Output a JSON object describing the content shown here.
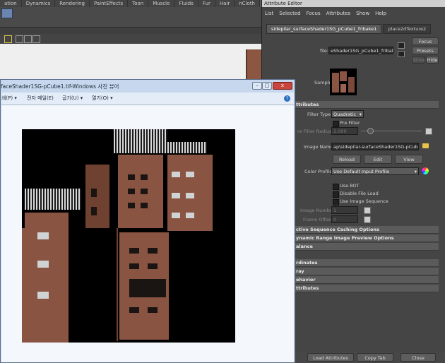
{
  "maya": {
    "shelf_tabs": [
      "ation",
      "Dynamics",
      "Rendering",
      "PaintEffects",
      "Toon",
      "Muscle",
      "Fluids",
      "Fur",
      "Hair",
      "nCloth",
      "Custom"
    ],
    "active_shelf_tab": "Custom"
  },
  "attribute_editor": {
    "title": "Attribute Editor",
    "menu": [
      "List",
      "Selected",
      "Focus",
      "Attributes",
      "Show",
      "Help"
    ],
    "tabs": [
      "sidepilar_surfaceShader1SG_pCube1_fribake1",
      "place2dTexture2"
    ],
    "focus_button": "Focus",
    "presets_button": "Presets",
    "show_button": "Show",
    "hide_button": "Hide",
    "file_label": "file:",
    "file_value": "eShader1SG_pCube1_fribake1",
    "sample_label": "Sample",
    "sections": {
      "attributes": "ttributes",
      "caching": "ctive Sequence Caching Options",
      "dynamic_range": "ynamic Range Image Preview Options",
      "balance": "alance",
      "coordinates": "rdinates",
      "ray": "ray",
      "behavior": "ehavior",
      "extra": "ttributes"
    },
    "filter_type_label": "Filter Type",
    "filter_type_value": "Quadratic",
    "pre_filter_label": "Pre Filter",
    "pre_filter_radius_label": "re Filter Radius",
    "pre_filter_radius_value": "2.000",
    "image_name_label": "Image Name",
    "image_name_value": "ap\\sidepilar-surfaceShader1SG-pCube1.tif",
    "reload_button": "Reload",
    "edit_button": "Edit",
    "view_button": "View",
    "color_profile_label": "Color Profile",
    "color_profile_value": "Use Default Input Profile",
    "use_bot_label": "Use BOT",
    "disable_file_load_label": "Disable File Load",
    "use_image_sequence_label": "Use Image Sequence",
    "image_number_label": "Image Number",
    "image_number_value": "1",
    "frame_offset_label": "Frame Offset",
    "frame_offset_value": "0",
    "load_attributes_button": "Load Attributes",
    "copy_tab_button": "Copy Tab",
    "close_button": "Close"
  },
  "photo_viewer": {
    "title": "faceShader1SG-pCube1.tif-Windows 사진 뷰어",
    "menu": [
      "쇄(P) ▾",
      "전자 메일(E)",
      "굽기(U) ▾",
      "열기(O) ▾"
    ],
    "help": "?",
    "minimize": "–",
    "maximize": "□",
    "close": "x"
  }
}
